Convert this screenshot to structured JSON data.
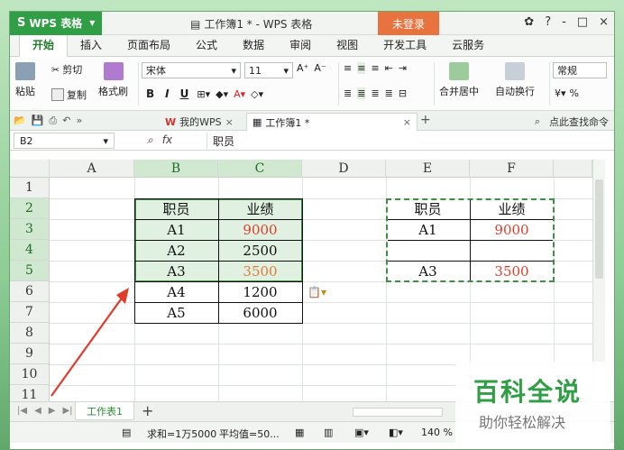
{
  "app": {
    "menu_button": "WPS 表格",
    "window_title": "工作簿1 * - WPS 表格",
    "login": "未登录",
    "window_buttons": [
      "?",
      "-",
      "□",
      "×"
    ]
  },
  "menu": [
    "开始",
    "插入",
    "页面布局",
    "公式",
    "数据",
    "审阅",
    "视图",
    "开发工具",
    "云服务"
  ],
  "ribbon": {
    "paste": "粘贴",
    "cut": "剪切",
    "copy": "复制",
    "format_painter": "格式刷",
    "font": "宋体",
    "size": "11",
    "bold": "B",
    "italic": "I",
    "underline": "U",
    "merge": "合并居中",
    "wrap": "自动换行",
    "number_format": "常规",
    "percent": "%"
  },
  "doc_tabs": {
    "my_wps": "我的WPS",
    "workbook": "工作簿1 *",
    "search": "点此查找命令"
  },
  "formula_bar": {
    "name_box": "B2",
    "content": "职员"
  },
  "columns": [
    "A",
    "B",
    "C",
    "D",
    "E",
    "F"
  ],
  "rows": [
    "1",
    "2",
    "3",
    "4",
    "5",
    "6",
    "7",
    "8",
    "9",
    "10",
    "11"
  ],
  "table_left": {
    "header": [
      "职员",
      "业绩"
    ],
    "rows": [
      [
        "A1",
        "9000"
      ],
      [
        "A2",
        "2500"
      ],
      [
        "A3",
        "3500"
      ],
      [
        "A4",
        "1200"
      ],
      [
        "A5",
        "6000"
      ]
    ]
  },
  "table_right": {
    "header": [
      "职员",
      "业绩"
    ],
    "rows": [
      [
        "A1",
        "9000"
      ],
      [
        "",
        ""
      ],
      [
        "A3",
        "3500"
      ]
    ]
  },
  "sheet": {
    "tab": "工作表1",
    "add": "+"
  },
  "status": {
    "sum": "求和=1万5000",
    "average": "平均值=50...",
    "zoom": "140 %"
  },
  "watermark": {
    "title": "百科全说",
    "subtitle": "助你轻松解决"
  }
}
